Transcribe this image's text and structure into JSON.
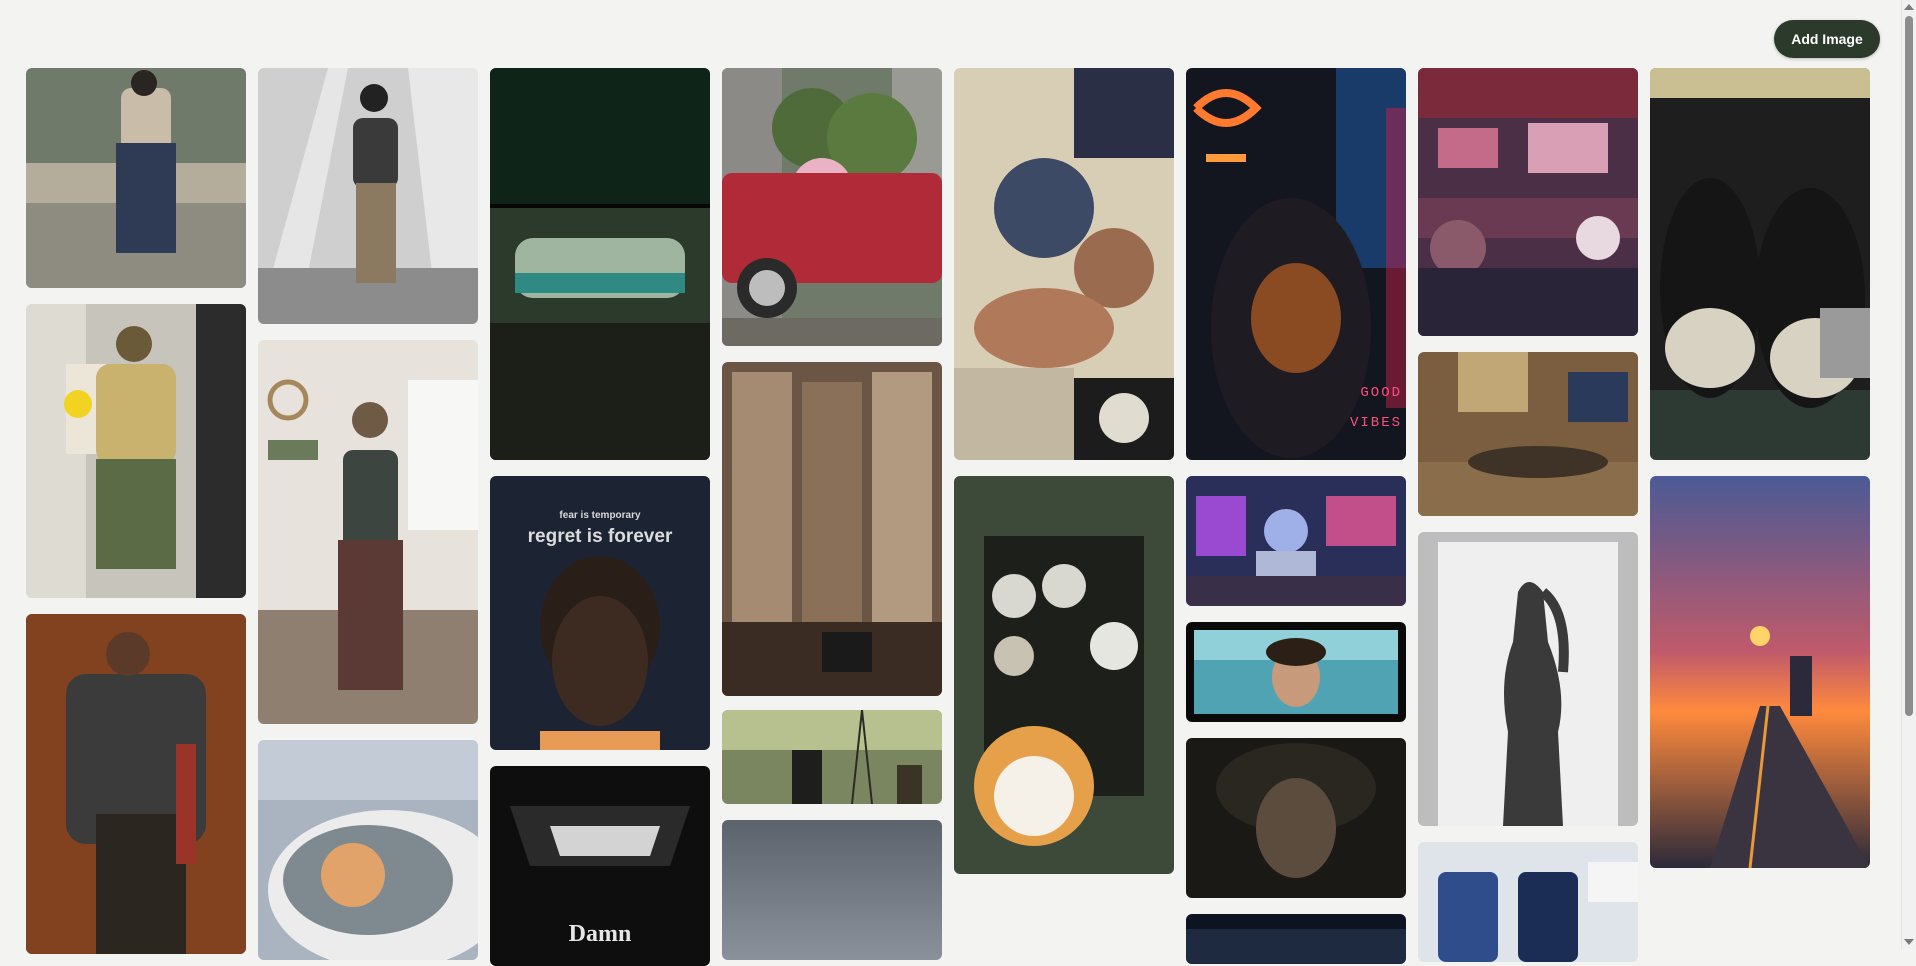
{
  "toolbar": {
    "add_label": "Add Image"
  },
  "gallery": {
    "overlays": {
      "bryant_small": "fear is temporary",
      "bryant_big": "regret is forever",
      "damn": "Damn",
      "good": "GOOD",
      "vibes": "VIBES"
    },
    "tiles": [
      {
        "id": "t1",
        "subject": "woman in cardigan and navy skirt on bridge",
        "palette": [
          "#6f7a6a",
          "#c9bca8",
          "#2f3a55"
        ]
      },
      {
        "id": "t2",
        "subject": "girl on white stairs in leather jacket",
        "palette": [
          "#cfcfcf",
          "#8c8c8c",
          "#3a3a3a"
        ]
      },
      {
        "id": "t3",
        "subject": "green bus in forest",
        "palette": [
          "#0f2419",
          "#9fb5a0",
          "#1b1f18"
        ]
      },
      {
        "id": "t4",
        "subject": "red car covered in flowers",
        "palette": [
          "#b12a37",
          "#4f6b3a",
          "#e9b3c5"
        ]
      },
      {
        "id": "t5",
        "subject": "anatomy collage",
        "palette": [
          "#d8cdb5",
          "#3c4a66",
          "#9a6b4f"
        ]
      },
      {
        "id": "t6",
        "subject": "hooded lion in neon",
        "palette": [
          "#14161f",
          "#ff7a2f",
          "#c01f4a"
        ]
      },
      {
        "id": "t7",
        "subject": "anime bar interior",
        "palette": [
          "#4a2f47",
          "#c46b8a",
          "#2a2438"
        ]
      },
      {
        "id": "t8",
        "subject": "black converse sneakers",
        "palette": [
          "#1e1e1e",
          "#d8d2c2",
          "#2d3a33"
        ]
      },
      {
        "id": "t9",
        "subject": "woman in yellow sweater and green skirt",
        "palette": [
          "#c7c4bc",
          "#c9b26d",
          "#5a6b45"
        ]
      },
      {
        "id": "t10",
        "subject": "woman in room with plants",
        "palette": [
          "#e7e3dc",
          "#5b3a36",
          "#6b7a5a"
        ]
      },
      {
        "id": "t11",
        "subject": "room full of books",
        "palette": [
          "#6b5544",
          "#a58b72",
          "#3a2c22"
        ]
      },
      {
        "id": "t12",
        "subject": "cats in hoodies",
        "palette": [
          "#3d4a3a",
          "#e6a04a",
          "#1c1f1a"
        ]
      },
      {
        "id": "t13",
        "subject": "anime girl gaming setup",
        "palette": [
          "#2a2f5a",
          "#9fb0e8",
          "#c24e8a"
        ]
      },
      {
        "id": "t14",
        "subject": "man sleeping on floor",
        "palette": [
          "#7a5e3f",
          "#c1a676",
          "#3f3226"
        ]
      },
      {
        "id": "t15",
        "subject": "silhouette of woman",
        "palette": [
          "#efefef",
          "#3a3a3a",
          "#bdbdbd"
        ]
      },
      {
        "id": "t16",
        "subject": "sunset road anime",
        "palette": [
          "#4b5a95",
          "#ff8a3d",
          "#2c2a3a"
        ]
      },
      {
        "id": "t17",
        "subject": "Kobe Bryant portrait",
        "palette": [
          "#1c2333",
          "#3d2a20",
          "#e89a57"
        ]
      },
      {
        "id": "t18",
        "subject": "men under power tower",
        "palette": [
          "#7a8660",
          "#b7c08f",
          "#2a2a26"
        ]
      },
      {
        "id": "t19",
        "subject": "man with blue background",
        "palette": [
          "#4fa3b2",
          "#2c2016",
          "#8fd0d9"
        ]
      },
      {
        "id": "t20",
        "subject": "dark portrait with hair",
        "palette": [
          "#1b1915",
          "#5b4c3d",
          "#2a2620"
        ]
      },
      {
        "id": "t21",
        "subject": "woman in brown skirt with jacket",
        "palette": [
          "#7a3b1c",
          "#3b3b3b",
          "#c9b08a"
        ]
      },
      {
        "id": "t22",
        "subject": "cat in car mirror",
        "palette": [
          "#a9b4c0",
          "#e2a36a",
          "#ececec"
        ]
      },
      {
        "id": "t23",
        "subject": "black frame Damn",
        "palette": [
          "#0e0e0e",
          "#e6e6e6",
          "#2a2a2a"
        ]
      },
      {
        "id": "t24",
        "subject": "grey sky",
        "palette": [
          "#6f7680",
          "#8a919b",
          "#5c636c"
        ]
      },
      {
        "id": "t25",
        "subject": "dark image bottom",
        "palette": [
          "#0d1320",
          "#1e2a40",
          "#0a0a0a"
        ]
      },
      {
        "id": "t26",
        "subject": "blue chairs",
        "palette": [
          "#2f4d8a",
          "#dfe4ea",
          "#1b2d55"
        ]
      }
    ]
  }
}
